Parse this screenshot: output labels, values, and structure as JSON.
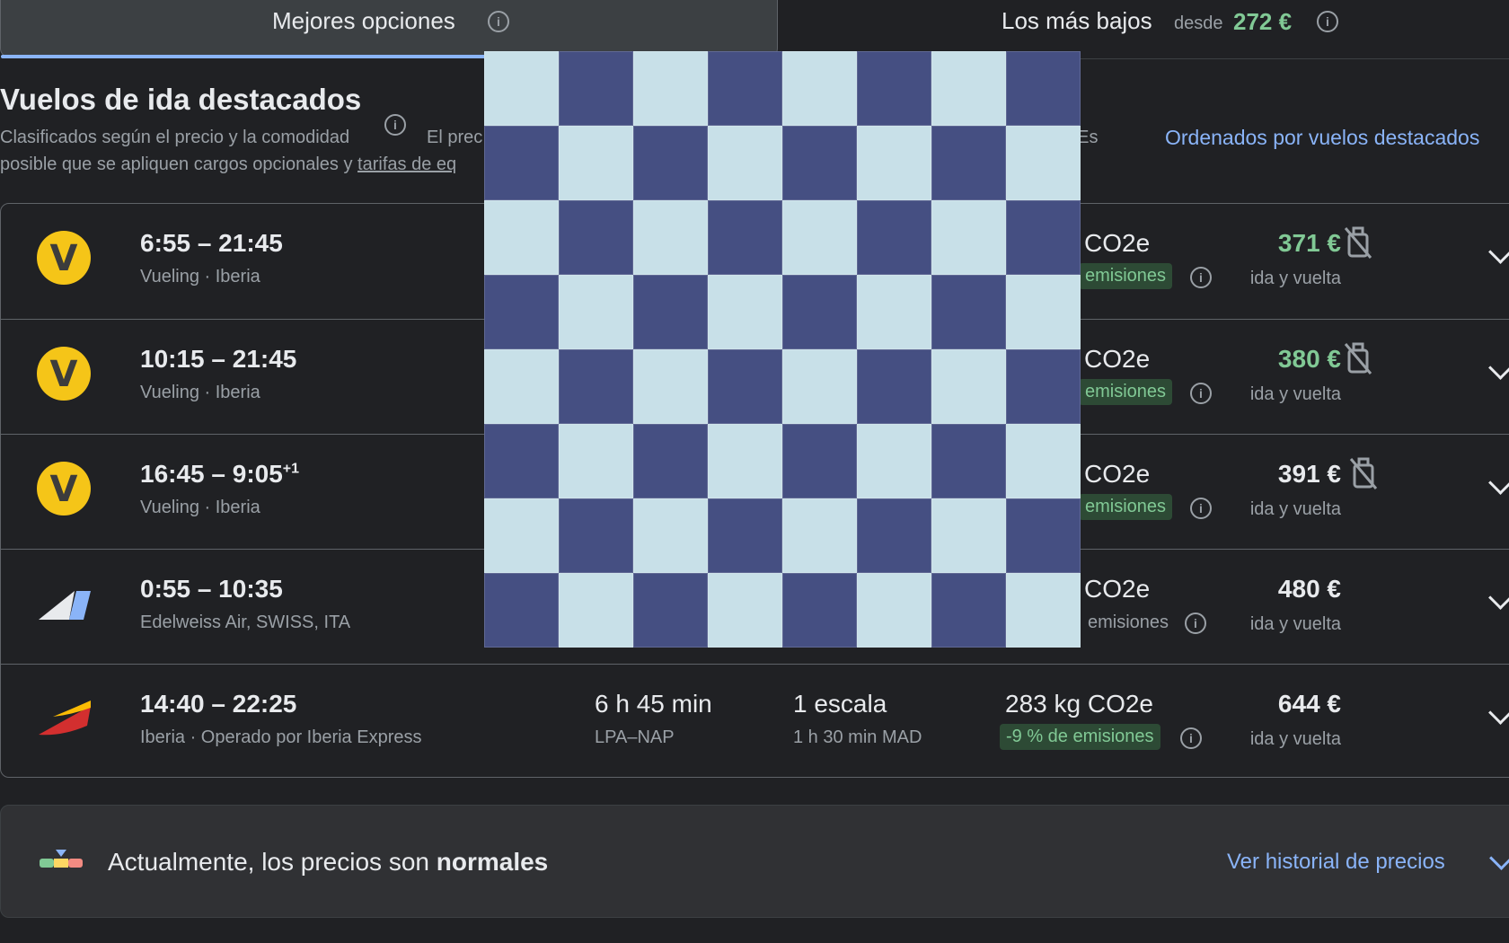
{
  "tabs": {
    "best": {
      "label": "Mejores opciones",
      "info_icon": "info-icon"
    },
    "lowest": {
      "label": "Los más bajos",
      "from_label": "desde",
      "from_price": "272 €",
      "info_icon": "info-icon"
    }
  },
  "section": {
    "title": "Vuelos de ida destacados",
    "subtitle_line1_a": "Clasificados según el precio y la comodidad",
    "subtitle_line1_b": "El prec",
    "subtitle_line1_c": ". Es",
    "subtitle_line2_a": "posible que se apliquen cargos opcionales y ",
    "subtitle_line2_link": "tarifas de eq",
    "sort_label": "Ordenados por vuelos destacados"
  },
  "flights": [
    {
      "logo": "vueling-logo",
      "times": "6:55 – 21:45",
      "day_offset": "",
      "airline": "Vueling · Iberia",
      "duration": "",
      "route": "",
      "stops": "",
      "stop_info": "",
      "co2": "CO2e",
      "emissions": "emisiones",
      "emissions_badge": true,
      "price": "371 €",
      "price_green": true,
      "no_bag_icon": true,
      "trip": "ida y vuelta"
    },
    {
      "logo": "vueling-logo",
      "times": "10:15 – 21:45",
      "day_offset": "",
      "airline": "Vueling · Iberia",
      "duration": "",
      "route": "",
      "stops": "",
      "stop_info": "",
      "co2": "CO2e",
      "emissions": "emisiones",
      "emissions_badge": true,
      "price": "380 €",
      "price_green": true,
      "no_bag_icon": true,
      "trip": "ida y vuelta"
    },
    {
      "logo": "vueling-logo",
      "times": "16:45 – 9:05",
      "day_offset": "+1",
      "airline": "Vueling · Iberia",
      "duration": "",
      "route": "",
      "stops": "",
      "stop_info": "",
      "co2": "CO2e",
      "emissions": "emisiones",
      "emissions_badge": true,
      "price": "391 €",
      "price_green": false,
      "no_bag_icon": true,
      "trip": "ida y vuelta"
    },
    {
      "logo": "edelweiss-logo",
      "times": "0:55 – 10:35",
      "day_offset": "",
      "airline": "Edelweiss Air, SWISS, ITA",
      "duration": "",
      "route": "",
      "stops": "",
      "stop_info": "",
      "co2": "CO2e",
      "emissions": "emisiones",
      "emissions_badge": false,
      "price": "480 €",
      "price_green": false,
      "no_bag_icon": false,
      "trip": "ida y vuelta"
    },
    {
      "logo": "iberia-logo",
      "times": "14:40 – 22:25",
      "day_offset": "",
      "airline": "Iberia · Operado por Iberia Express",
      "duration": "6 h 45 min",
      "route": "LPA–NAP",
      "stops": "1 escala",
      "stop_info": "1 h 30 min MAD",
      "co2": "283 kg CO2e",
      "emissions": "-9 % de emisiones",
      "emissions_badge": true,
      "price": "644 €",
      "price_green": false,
      "no_bag_icon": false,
      "trip": "ida y vuelta"
    }
  ],
  "price_insight": {
    "text_prefix": "Actualmente, los precios son ",
    "text_bold": "normales",
    "link": "Ver historial de precios"
  },
  "overlay": {
    "icon": "checkerboard-placeholder",
    "colors": {
      "light": "#c8e0e8",
      "dark": "#454f82"
    }
  }
}
